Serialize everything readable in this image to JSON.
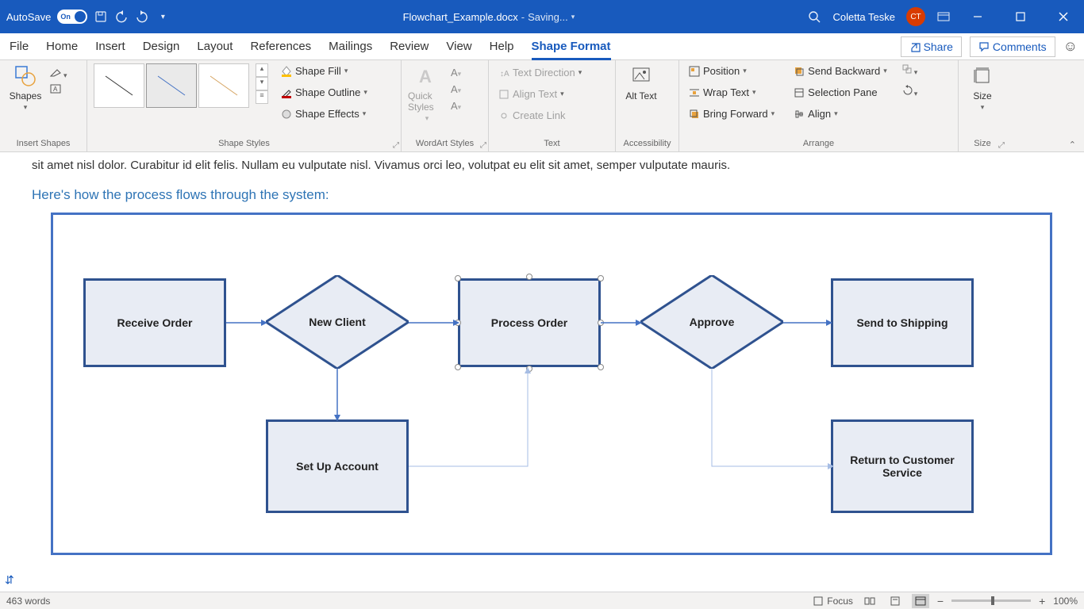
{
  "titlebar": {
    "autosave_label": "AutoSave",
    "autosave_state": "On",
    "filename": "Flowchart_Example.docx",
    "save_status": "Saving...",
    "user_name": "Coletta Teske",
    "user_initials": "CT"
  },
  "tabs": {
    "items": [
      "File",
      "Home",
      "Insert",
      "Design",
      "Layout",
      "References",
      "Mailings",
      "Review",
      "View",
      "Help",
      "Shape Format"
    ],
    "active": "Shape Format",
    "share": "Share",
    "comments": "Comments"
  },
  "ribbon": {
    "insert_shapes": {
      "shapes": "Shapes",
      "label": "Insert Shapes"
    },
    "shape_styles": {
      "fill": "Shape Fill",
      "outline": "Shape Outline",
      "effects": "Shape Effects",
      "label": "Shape Styles"
    },
    "wordart": {
      "quick_styles": "Quick Styles",
      "label": "WordArt Styles"
    },
    "text": {
      "direction": "Text Direction",
      "align": "Align Text",
      "link": "Create Link",
      "label": "Text"
    },
    "accessibility": {
      "alt_text": "Alt Text",
      "label": "Accessibility"
    },
    "arrange": {
      "position": "Position",
      "wrap": "Wrap Text",
      "forward": "Bring Forward",
      "backward": "Send Backward",
      "selection_pane": "Selection Pane",
      "align": "Align",
      "label": "Arrange"
    },
    "size": {
      "label": "Size",
      "btn": "Size"
    }
  },
  "document": {
    "truncated_text": "sit amet nisl dolor. Curabitur id elit felis. Nullam eu vulputate nisl. Vivamus orci leo, volutpat eu elit sit amet, semper vulputate mauris.",
    "section_title": "Here's how the process flows through the system:",
    "flowchart": {
      "receive_order": "Receive Order",
      "new_client": "New Client",
      "process_order": "Process Order",
      "approve": "Approve",
      "send_shipping": "Send to Shipping",
      "setup_account": "Set Up Account",
      "return_cs": "Return to Customer Service"
    }
  },
  "statusbar": {
    "word_count": "463 words",
    "focus": "Focus",
    "zoom": "100%"
  }
}
